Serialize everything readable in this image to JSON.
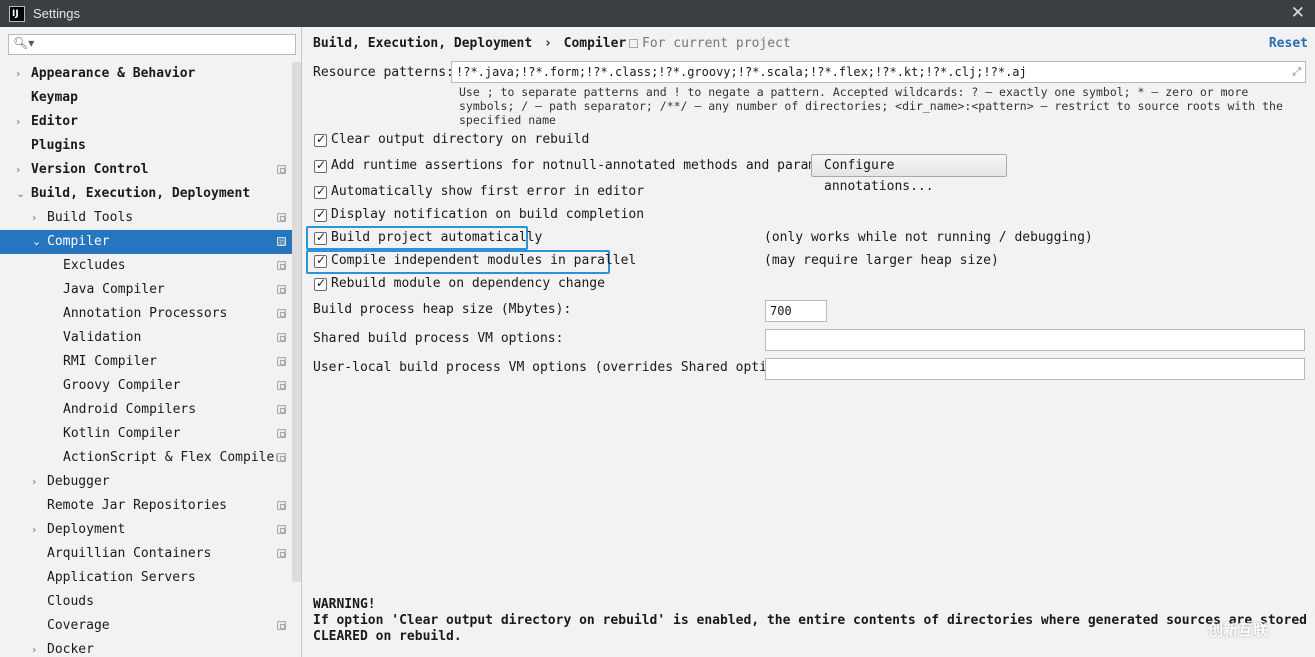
{
  "window": {
    "title": "Settings"
  },
  "search": {
    "placeholder": ""
  },
  "sidebar": {
    "items": [
      {
        "label": "Appearance & Behavior",
        "arrow": "›",
        "bold": true
      },
      {
        "label": "Keymap",
        "bold": true
      },
      {
        "label": "Editor",
        "arrow": "›",
        "bold": true
      },
      {
        "label": "Plugins",
        "bold": true
      },
      {
        "label": "Version Control",
        "arrow": "›",
        "bold": true,
        "project": true
      },
      {
        "label": "Build, Execution, Deployment",
        "arrow": "⌄",
        "bold": true
      },
      {
        "label": "Build Tools",
        "arrow": "›",
        "project": true
      },
      {
        "label": "Compiler",
        "arrow": "⌄",
        "project": true,
        "selected": true
      },
      {
        "label": "Excludes",
        "project": true
      },
      {
        "label": "Java Compiler",
        "project": true
      },
      {
        "label": "Annotation Processors",
        "project": true
      },
      {
        "label": "Validation",
        "project": true
      },
      {
        "label": "RMI Compiler",
        "project": true
      },
      {
        "label": "Groovy Compiler",
        "project": true
      },
      {
        "label": "Android Compilers",
        "project": true
      },
      {
        "label": "Kotlin Compiler",
        "project": true
      },
      {
        "label": "ActionScript & Flex Compiler",
        "project": true
      },
      {
        "label": "Debugger",
        "arrow": "›"
      },
      {
        "label": "Remote Jar Repositories",
        "project": true
      },
      {
        "label": "Deployment",
        "arrow": "›",
        "project": true
      },
      {
        "label": "Arquillian Containers",
        "project": true
      },
      {
        "label": "Application Servers"
      },
      {
        "label": "Clouds"
      },
      {
        "label": "Coverage",
        "project": true
      },
      {
        "label": "Docker",
        "arrow": "›"
      }
    ]
  },
  "header": {
    "breadcrumb_parent": "Build, Execution, Deployment",
    "breadcrumb_sep": "›",
    "breadcrumb_current": "Compiler",
    "scope": "For current project",
    "reset": "Reset"
  },
  "resource": {
    "label": "Resource patterns:",
    "value": "!?*.java;!?*.form;!?*.class;!?*.groovy;!?*.scala;!?*.flex;!?*.kt;!?*.clj;!?*.aj",
    "hint_line1": "Use ; to separate patterns and ! to negate a pattern. Accepted wildcards: ? — exactly one symbol; * — zero or more",
    "hint_line2": "symbols; / — path separator; /**/ — any number of directories; <dir_name>:<pattern> — restrict to source roots with the",
    "hint_line3": "specified name"
  },
  "options": {
    "clear_output": "Clear output directory on rebuild",
    "runtime_assertions": "Add runtime assertions for notnull-annotated methods and parameters",
    "configure_annotations": "Configure annotations...",
    "show_first_error": "Automatically show first error in editor",
    "display_notification": "Display notification on build completion",
    "build_auto": "Build project automatically",
    "build_auto_note": "(only works while not running / debugging)",
    "compile_parallel": "Compile independent modules in parallel",
    "compile_parallel_note": "(may require larger heap size)",
    "rebuild_module": "Rebuild module on dependency change"
  },
  "heap": {
    "label": "Build process heap size (Mbytes):",
    "value": "700"
  },
  "shared_vm": {
    "label": "Shared build process VM options:",
    "value": ""
  },
  "user_vm": {
    "label": "User-local build process VM options (overrides Shared options):",
    "value": ""
  },
  "warning": {
    "title": "WARNING!",
    "line1": "If option 'Clear output directory on rebuild' is enabled, the entire contents of directories where generated sources are stored WILL BE",
    "line2": "CLEARED on rebuild."
  },
  "watermark": "创新互联",
  "colors": {
    "selection": "#2675bf",
    "highlight": "#2b93d9",
    "link": "#2470b3"
  }
}
